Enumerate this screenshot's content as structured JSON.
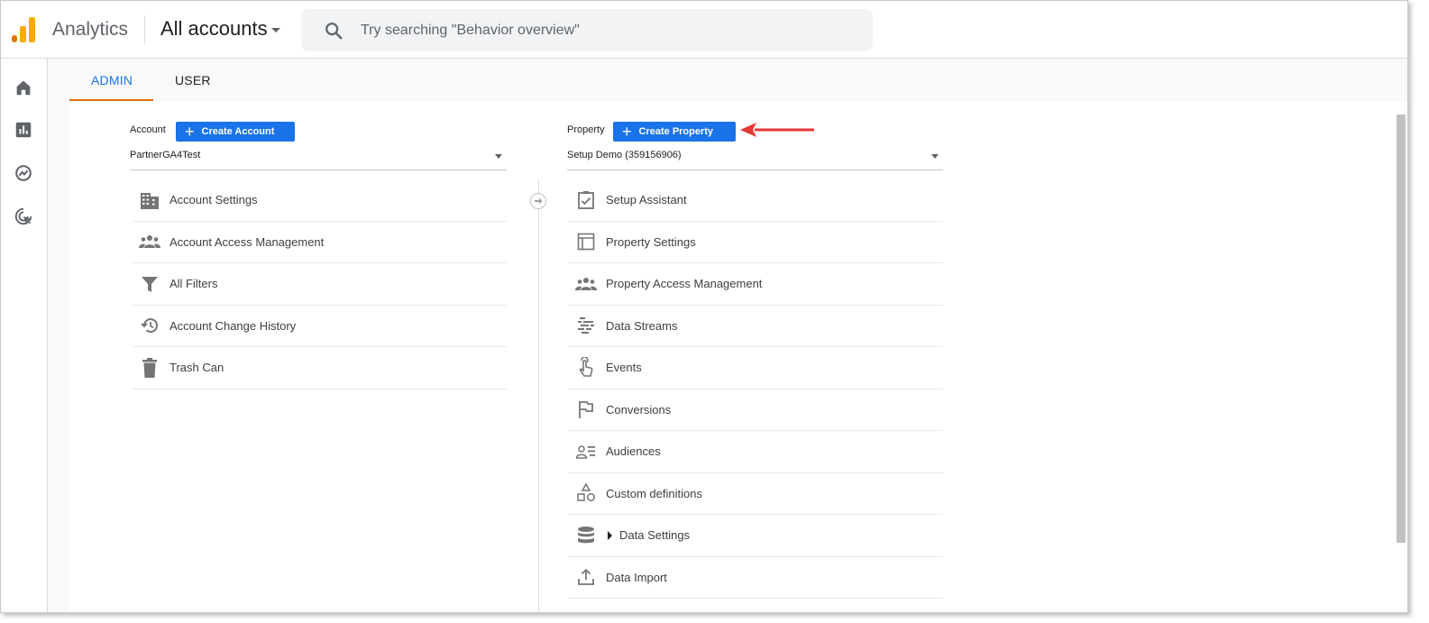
{
  "header": {
    "app_title": "Analytics",
    "account_selector": "All accounts",
    "search_placeholder": "Try searching \"Behavior overview\"",
    "logo_colors": [
      "#f9ab00",
      "#e37400"
    ]
  },
  "rail": {
    "items": [
      {
        "icon": "home-icon"
      },
      {
        "icon": "reports-icon"
      },
      {
        "icon": "explore-icon"
      },
      {
        "icon": "advertising-icon"
      }
    ]
  },
  "tabs": [
    {
      "label": "ADMIN",
      "active": true
    },
    {
      "label": "USER",
      "active": false
    }
  ],
  "account": {
    "label": "Account",
    "create_button": "Create Account",
    "selected": "PartnerGA4Test",
    "items": [
      {
        "label": "Account Settings",
        "icon": "building-icon"
      },
      {
        "label": "Account Access Management",
        "icon": "people-icon"
      },
      {
        "label": "All Filters",
        "icon": "filter-icon"
      },
      {
        "label": "Account Change History",
        "icon": "history-icon"
      },
      {
        "label": "Trash Can",
        "icon": "trash-icon"
      }
    ]
  },
  "property": {
    "label": "Property",
    "create_button": "Create Property",
    "selected": "Setup Demo (359156906)",
    "items": [
      {
        "label": "Setup Assistant",
        "icon": "checkbox-icon"
      },
      {
        "label": "Property Settings",
        "icon": "layout-icon"
      },
      {
        "label": "Property Access Management",
        "icon": "people-icon"
      },
      {
        "label": "Data Streams",
        "icon": "streams-icon"
      },
      {
        "label": "Events",
        "icon": "touch-icon"
      },
      {
        "label": "Conversions",
        "icon": "flag-icon"
      },
      {
        "label": "Audiences",
        "icon": "audiences-icon"
      },
      {
        "label": "Custom definitions",
        "icon": "shapes-icon"
      },
      {
        "label": "Data Settings",
        "icon": "database-icon",
        "expandable": true
      },
      {
        "label": "Data Import",
        "icon": "upload-icon"
      }
    ]
  },
  "colors": {
    "accent_blue": "#1a73e8",
    "tab_underline": "#e8710a",
    "annotation_arrow": "#e53935"
  }
}
